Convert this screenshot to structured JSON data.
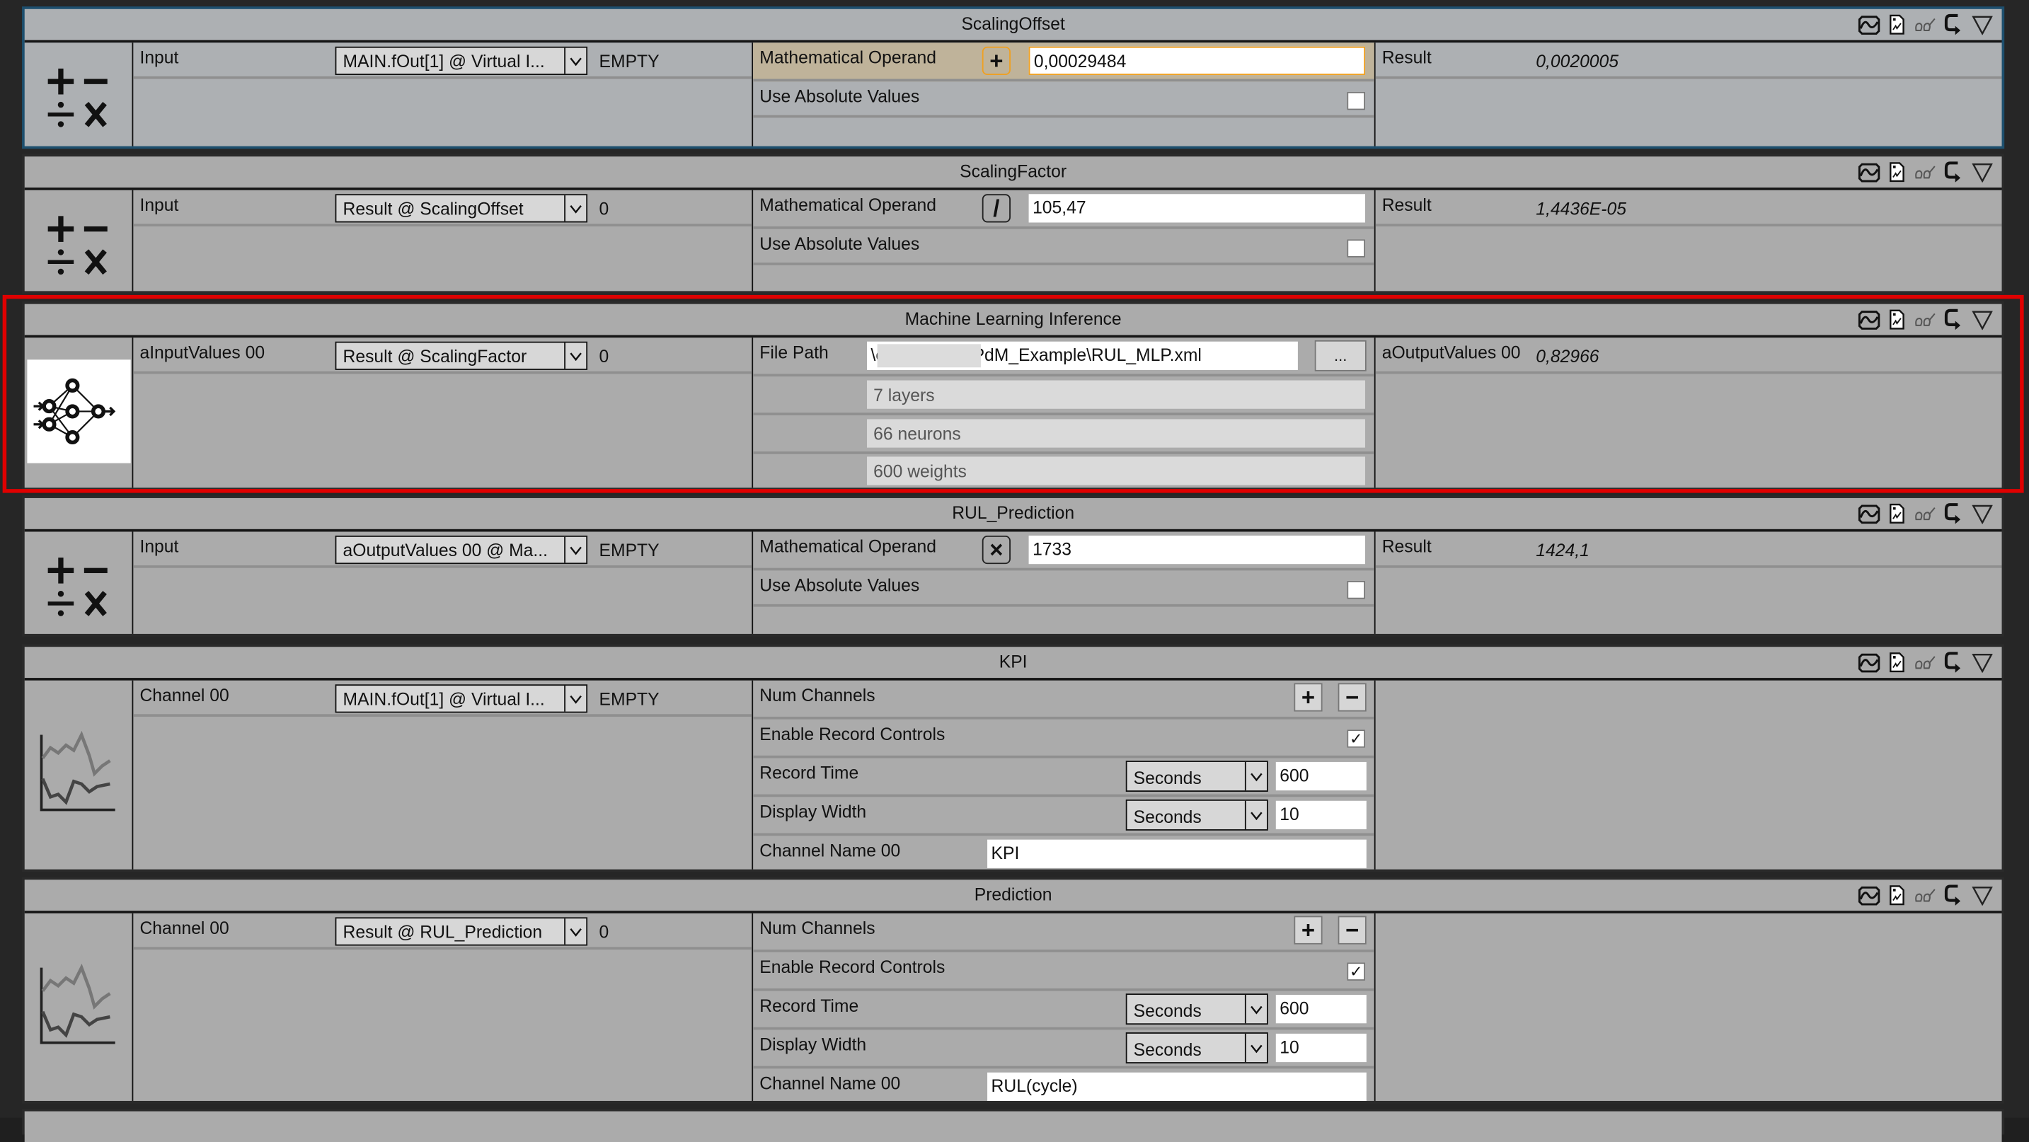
{
  "header_tools": [
    "scope-view-icon",
    "export-icon",
    "glasses-icon",
    "redirect-icon",
    "collapse-icon"
  ],
  "blocks": {
    "scaling_offset": {
      "title": "ScalingOffset",
      "icon": "math-operations-icon",
      "input_label": "Input",
      "input_source": "MAIN.fOut[1] @ Virtual I...",
      "input_value": "EMPTY",
      "operand_label": "Mathematical Operand",
      "operator": "+",
      "operand_value": "0,00029484",
      "abs_label": "Use Absolute Values",
      "abs_checked": false,
      "result_label": "Result",
      "result_value": "0,0020005"
    },
    "scaling_factor": {
      "title": "ScalingFactor",
      "icon": "math-operations-icon",
      "input_label": "Input",
      "input_source": "Result @ ScalingOffset",
      "input_value": "0",
      "operand_label": "Mathematical Operand",
      "operator": "/",
      "operand_value": "105,47",
      "abs_label": "Use Absolute Values",
      "abs_checked": false,
      "result_label": "Result",
      "result_value": "1,4436E-05"
    },
    "ml_inference": {
      "title": "Machine Learning Inference",
      "icon": "neural-network-icon",
      "input_label": "aInputValues 00",
      "input_source": "Result @ ScalingFactor",
      "input_value": "0",
      "file_path_label": "File Path",
      "file_path_value": "\\c          n\\Desktop\\PdM_Example\\RUL_MLP.xml",
      "browse_label": "...",
      "info": [
        "7 layers",
        "66 neurons",
        "600 weights"
      ],
      "output_label": "aOutputValues 00",
      "output_value": "0,82966"
    },
    "rul_prediction": {
      "title": "RUL_Prediction",
      "icon": "math-operations-icon",
      "input_label": "Input",
      "input_source": "aOutputValues 00 @ Ma...",
      "input_value": "EMPTY",
      "operand_label": "Mathematical Operand",
      "operator": "×",
      "operand_value": "1733",
      "abs_label": "Use Absolute Values",
      "abs_checked": false,
      "result_label": "Result",
      "result_value": "1424,1"
    },
    "kpi": {
      "title": "KPI",
      "icon": "line-chart-icon",
      "channel_label": "Channel 00",
      "channel_source": "MAIN.fOut[1] @ Virtual I...",
      "channel_value": "EMPTY",
      "num_channels_label": "Num Channels",
      "enable_record_label": "Enable Record Controls",
      "enable_record_checked": true,
      "record_time_label": "Record Time",
      "record_time_unit": "Seconds",
      "record_time_value": "600",
      "display_width_label": "Display Width",
      "display_width_unit": "Seconds",
      "display_width_value": "10",
      "channel_name_label": "Channel Name 00",
      "channel_name_value": "KPI"
    },
    "prediction": {
      "title": "Prediction",
      "icon": "line-chart-icon",
      "channel_label": "Channel 00",
      "channel_source": "Result @ RUL_Prediction",
      "channel_value": "0",
      "num_channels_label": "Num Channels",
      "enable_record_label": "Enable Record Controls",
      "enable_record_checked": true,
      "record_time_label": "Record Time",
      "record_time_unit": "Seconds",
      "record_time_value": "600",
      "display_width_label": "Display Width",
      "display_width_unit": "Seconds",
      "display_width_value": "10",
      "channel_name_label": "Channel Name 00",
      "channel_name_value": "RUL(cycle)"
    }
  },
  "symbols": {
    "plus": "+",
    "minus": "−",
    "check": "✓",
    "arrow": "⌄"
  },
  "colors": {
    "selected_block_border": "#1d4f6e",
    "highlight_outline": "#e00000",
    "focused_field": "#f0a020",
    "panel_bg": "#ababab"
  }
}
